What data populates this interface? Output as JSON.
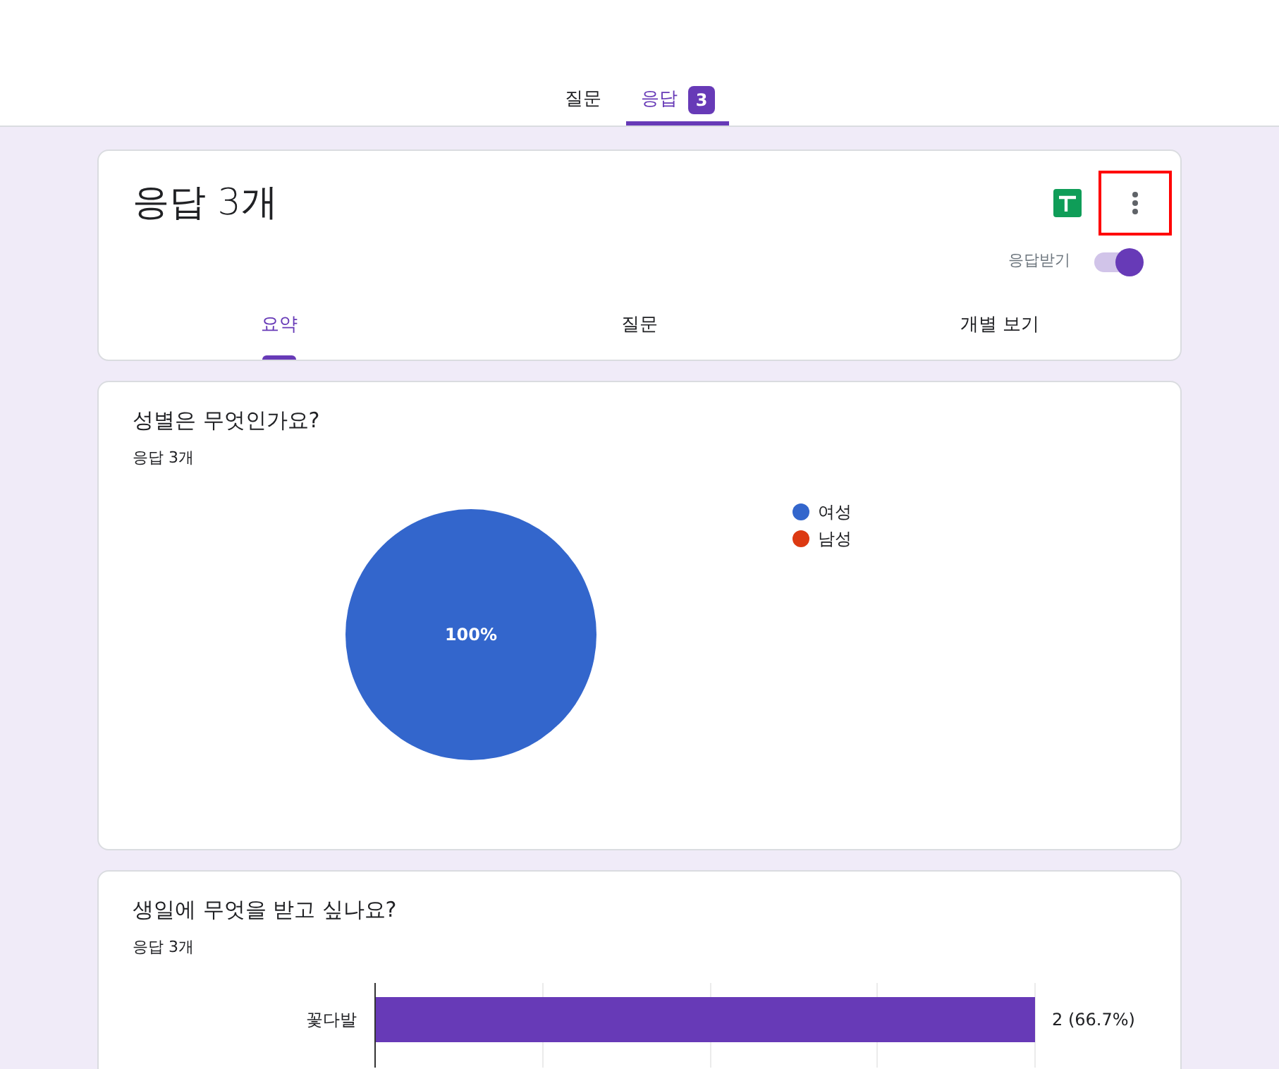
{
  "top_tabs": [
    {
      "label": "질문",
      "selected": false
    },
    {
      "label": "응답",
      "selected": true,
      "badge": "3"
    }
  ],
  "summary": {
    "title": "응답 3개",
    "menu_highlighted": true,
    "accepting_label": "응답받기",
    "accepting": true,
    "tabs": [
      {
        "label": "요약",
        "selected": true
      },
      {
        "label": "질문",
        "selected": false
      },
      {
        "label": "개별 보기",
        "selected": false
      }
    ]
  },
  "questions": [
    {
      "title": "성별은 무엇인가요?",
      "count": "응답 3개",
      "chart_data": {
        "type": "pie",
        "categories": [
          "여성",
          "남성"
        ],
        "values": [
          100,
          0
        ],
        "colors": [
          "#3366cc",
          "#dc3912"
        ],
        "value_labels": [
          "100%",
          null
        ]
      }
    },
    {
      "title": "생일에 무엇을 받고 싶나요?",
      "count": "응답 3개",
      "chart_data": {
        "type": "bar",
        "orientation": "horizontal",
        "categories": [
          "꽃다발"
        ],
        "values": [
          2
        ],
        "colors": [
          "#673ab7"
        ],
        "value_labels": [
          "2 (66.7%)"
        ]
      }
    }
  ]
}
